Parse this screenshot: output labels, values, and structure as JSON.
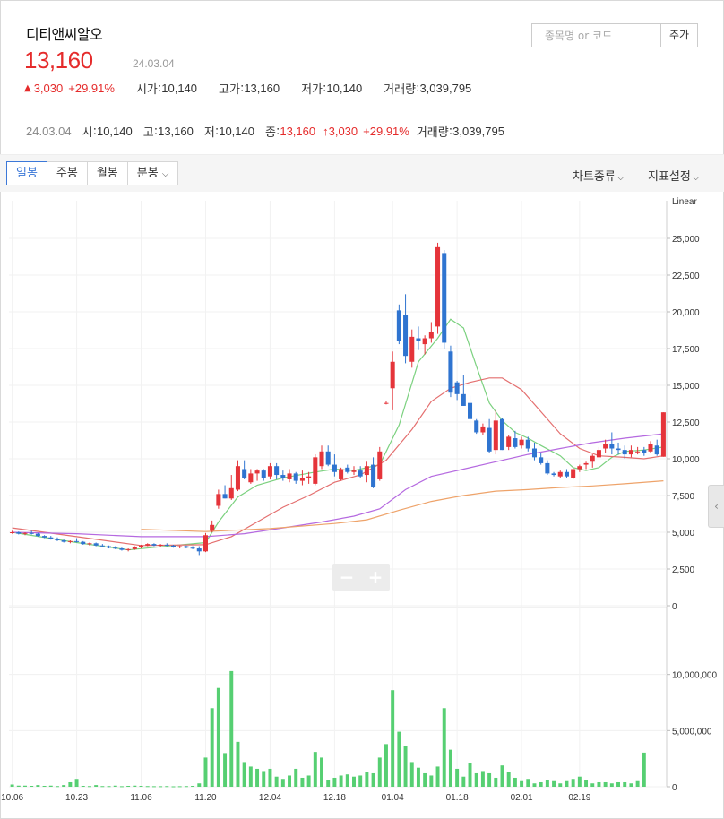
{
  "stock": {
    "name": "디티앤씨알오",
    "price": "13,160",
    "date": "24.03.04",
    "change_arrow": "▲",
    "change": "3,030",
    "change_pct": "+29.91%",
    "open_label": "시가",
    "open": "10,140",
    "high_label": "고가",
    "high": "13,160",
    "low_label": "저가",
    "low": "10,140",
    "volume_label": "거래량",
    "volume": "3,039,795"
  },
  "search": {
    "placeholder": "종목명 or 코드",
    "add_label": "추가"
  },
  "ohlc_row": {
    "date": "24.03.04",
    "open_label": "시",
    "open": "10,140",
    "high_label": "고",
    "high": "13,160",
    "low_label": "저",
    "low": "10,140",
    "close_label": "종",
    "close": "13,160",
    "change": "↑3,030",
    "change_pct": "+29.91%",
    "volume_label": "거래량",
    "volume": "3,039,795"
  },
  "toolbar": {
    "tabs": [
      "일봉",
      "주봉",
      "월봉",
      "분봉"
    ],
    "active_tab": 0,
    "chart_type": "차트종류",
    "indicator": "지표설정"
  },
  "colors": {
    "up": "#e5343a",
    "down": "#2f74d0",
    "ma5": "#7bd17f",
    "ma20": "#e46f6f",
    "ma60": "#b569e0",
    "ma120": "#eea36a",
    "volume": "#56cf72"
  },
  "chart_data": {
    "type": "candlestick",
    "scale_label": "Linear",
    "price_ticks": [
      0,
      2500,
      5000,
      7500,
      10000,
      12500,
      15000,
      17500,
      20000,
      22500,
      25000
    ],
    "volume_ticks": [
      0,
      5000000,
      10000000
    ],
    "ylim": [
      0,
      26000
    ],
    "volume_ylim": [
      0,
      13500000
    ],
    "x_ticks": [
      {
        "i": 0,
        "label": "10.06"
      },
      {
        "i": 10,
        "label": "10.23"
      },
      {
        "i": 20,
        "label": "11.06"
      },
      {
        "i": 30,
        "label": "11.20"
      },
      {
        "i": 40,
        "label": "12.04"
      },
      {
        "i": 50,
        "label": "12.18"
      },
      {
        "i": 59,
        "label": "01.04"
      },
      {
        "i": 69,
        "label": "01.18"
      },
      {
        "i": 79,
        "label": "02.01"
      },
      {
        "i": 88,
        "label": "02.19"
      }
    ],
    "candles": [
      [
        5000,
        5100,
        4900,
        5000
      ],
      [
        5000,
        5050,
        4850,
        4900
      ],
      [
        4900,
        5000,
        4800,
        4950
      ],
      [
        4950,
        5100,
        4850,
        4900
      ],
      [
        4900,
        4950,
        4700,
        4750
      ],
      [
        4750,
        4800,
        4600,
        4650
      ],
      [
        4650,
        4750,
        4500,
        4550
      ],
      [
        4550,
        4650,
        4400,
        4450
      ],
      [
        4450,
        4500,
        4300,
        4350
      ],
      [
        4350,
        4450,
        4250,
        4400
      ],
      [
        4400,
        4600,
        4300,
        4350
      ],
      [
        4350,
        4400,
        4150,
        4200
      ],
      [
        4200,
        4300,
        4100,
        4250
      ],
      [
        4250,
        4300,
        4050,
        4100
      ],
      [
        4100,
        4200,
        4000,
        4050
      ],
      [
        4050,
        4100,
        3900,
        3950
      ],
      [
        3950,
        4050,
        3850,
        3900
      ],
      [
        3900,
        3950,
        3750,
        3800
      ],
      [
        3800,
        3900,
        3700,
        3850
      ],
      [
        3850,
        4050,
        3800,
        4000
      ],
      [
        4000,
        4150,
        3900,
        4100
      ],
      [
        4100,
        4250,
        4050,
        4200
      ],
      [
        4200,
        4250,
        4050,
        4100
      ],
      [
        4100,
        4200,
        4000,
        4150
      ],
      [
        4150,
        4250,
        4050,
        4100
      ],
      [
        4100,
        4150,
        3950,
        4000
      ],
      [
        4000,
        4100,
        3900,
        4050
      ],
      [
        4050,
        4100,
        3900,
        3950
      ],
      [
        3950,
        4050,
        3850,
        3900
      ],
      [
        3900,
        4050,
        3450,
        3700
      ],
      [
        3700,
        4950,
        3650,
        4800
      ],
      [
        5100,
        5800,
        5000,
        5500
      ],
      [
        6800,
        7900,
        6600,
        7600
      ],
      [
        7600,
        8200,
        7300,
        7300
      ],
      [
        7300,
        8900,
        7200,
        8000
      ],
      [
        7900,
        9900,
        7800,
        9500
      ],
      [
        9300,
        9900,
        8600,
        8700
      ],
      [
        8400,
        9300,
        8300,
        9000
      ],
      [
        9000,
        9300,
        8500,
        9200
      ],
      [
        9200,
        9300,
        8500,
        8700
      ],
      [
        8800,
        9700,
        8600,
        9500
      ],
      [
        9500,
        9700,
        8600,
        8900
      ],
      [
        8900,
        9200,
        8500,
        8700
      ],
      [
        8600,
        9300,
        8400,
        9000
      ],
      [
        9000,
        9100,
        8300,
        8500
      ],
      [
        8500,
        9200,
        8200,
        8700
      ],
      [
        8700,
        9100,
        8300,
        8800
      ],
      [
        8300,
        10300,
        8200,
        10100
      ],
      [
        9500,
        10900,
        9300,
        10500
      ],
      [
        10500,
        10900,
        9500,
        9600
      ],
      [
        9600,
        10300,
        8800,
        9100
      ],
      [
        8600,
        9400,
        8500,
        9300
      ],
      [
        9400,
        9600,
        9000,
        9100
      ],
      [
        9100,
        9500,
        8900,
        9200
      ],
      [
        9200,
        9500,
        8700,
        8800
      ],
      [
        8900,
        9800,
        8400,
        9500
      ],
      [
        9600,
        10100,
        8000,
        8100
      ],
      [
        8600,
        10800,
        8500,
        10500
      ],
      [
        13800,
        13900,
        13700,
        13800
      ],
      [
        14800,
        17300,
        13300,
        16600
      ],
      [
        20100,
        20500,
        17800,
        18000
      ],
      [
        19800,
        21200,
        16500,
        17000
      ],
      [
        16600,
        18800,
        16200,
        18300
      ],
      [
        18200,
        19000,
        17400,
        18000
      ],
      [
        17800,
        18400,
        17100,
        18200
      ],
      [
        18200,
        19300,
        17900,
        18600
      ],
      [
        19000,
        24700,
        18500,
        24400
      ],
      [
        24000,
        24200,
        17500,
        17900
      ],
      [
        17300,
        17700,
        14200,
        14500
      ],
      [
        15200,
        15300,
        14000,
        14400
      ],
      [
        14400,
        15700,
        13600,
        13600
      ],
      [
        13800,
        14300,
        12000,
        12700
      ],
      [
        12600,
        12700,
        11700,
        11800
      ],
      [
        11800,
        12400,
        11600,
        12200
      ],
      [
        12100,
        12700,
        10400,
        10500
      ],
      [
        10600,
        13300,
        10300,
        12600
      ],
      [
        12700,
        12800,
        10600,
        10600
      ],
      [
        10800,
        11600,
        10600,
        11500
      ],
      [
        11400,
        11900,
        10700,
        10800
      ],
      [
        10900,
        11500,
        10700,
        11300
      ],
      [
        11300,
        11500,
        10500,
        10700
      ],
      [
        10700,
        11100,
        9900,
        10100
      ],
      [
        10100,
        10400,
        9600,
        9700
      ],
      [
        9700,
        9900,
        8900,
        9000
      ],
      [
        9000,
        9100,
        8800,
        8900
      ],
      [
        8800,
        9200,
        8700,
        9100
      ],
      [
        9100,
        9300,
        8700,
        8800
      ],
      [
        8700,
        9400,
        8600,
        9300
      ],
      [
        9300,
        9600,
        9100,
        9500
      ],
      [
        9600,
        9800,
        9300,
        9700
      ],
      [
        9800,
        10300,
        9400,
        10200
      ],
      [
        10100,
        10800,
        10100,
        10600
      ],
      [
        10700,
        11300,
        10400,
        11000
      ],
      [
        11000,
        11800,
        10300,
        10700
      ],
      [
        10700,
        11100,
        10300,
        10600
      ],
      [
        10600,
        10900,
        10000,
        10300
      ],
      [
        10300,
        10900,
        10100,
        10600
      ],
      [
        10500,
        10800,
        10300,
        10500
      ],
      [
        10600,
        10800,
        10200,
        10400
      ],
      [
        10500,
        11200,
        10400,
        11000
      ],
      [
        10900,
        11300,
        10200,
        10300
      ],
      [
        10140,
        13160,
        10140,
        13160
      ]
    ],
    "volumes": [
      200000,
      100000,
      100000,
      80000,
      150000,
      80000,
      100000,
      60000,
      150000,
      400000,
      700000,
      80000,
      60000,
      150000,
      60000,
      60000,
      100000,
      50000,
      80000,
      100000,
      80000,
      60000,
      50000,
      50000,
      60000,
      40000,
      50000,
      60000,
      80000,
      300000,
      2600000,
      7000000,
      8800000,
      3000000,
      10300000,
      4000000,
      2200000,
      1800000,
      1600000,
      1400000,
      1600000,
      900000,
      700000,
      1000000,
      1600000,
      800000,
      1000000,
      3100000,
      2600000,
      600000,
      800000,
      1000000,
      1100000,
      900000,
      1000000,
      1300000,
      1200000,
      2600000,
      3800000,
      8600000,
      4900000,
      3600000,
      2200000,
      1700000,
      1200000,
      1000000,
      1800000,
      7000000,
      3300000,
      1600000,
      900000,
      2100000,
      1200000,
      1400000,
      1200000,
      800000,
      1900000,
      1300000,
      800000,
      500000,
      700000,
      300000,
      400000,
      600000,
      500000,
      300000,
      500000,
      700000,
      900000,
      600000,
      300000,
      400000,
      400000,
      300000,
      400000,
      400000,
      300000,
      500000,
      3040000
    ],
    "moving_averages": [
      {
        "name": "MA5",
        "color": "#7bd17f",
        "points": [
          [
            0,
            5000
          ],
          [
            10,
            4300
          ],
          [
            18,
            3800
          ],
          [
            25,
            4100
          ],
          [
            30,
            4300
          ],
          [
            32,
            5700
          ],
          [
            35,
            7400
          ],
          [
            38,
            8200
          ],
          [
            42,
            8700
          ],
          [
            47,
            9100
          ],
          [
            50,
            9300
          ],
          [
            53,
            9200
          ],
          [
            57,
            9600
          ],
          [
            60,
            12300
          ],
          [
            63,
            16600
          ],
          [
            66,
            18200
          ],
          [
            68,
            19500
          ],
          [
            70,
            18900
          ],
          [
            72,
            16300
          ],
          [
            74,
            13800
          ],
          [
            76,
            12600
          ],
          [
            78,
            11800
          ],
          [
            80,
            11400
          ],
          [
            82,
            10900
          ],
          [
            85,
            10200
          ],
          [
            87,
            9400
          ],
          [
            89,
            9200
          ],
          [
            91,
            9400
          ],
          [
            93,
            10100
          ],
          [
            95,
            10500
          ],
          [
            98,
            10600
          ],
          [
            101,
            10800
          ]
        ]
      },
      {
        "name": "MA20",
        "color": "#e46f6f",
        "points": [
          [
            0,
            5300
          ],
          [
            10,
            4700
          ],
          [
            20,
            4100
          ],
          [
            30,
            4150
          ],
          [
            34,
            4700
          ],
          [
            38,
            5700
          ],
          [
            42,
            6700
          ],
          [
            46,
            7500
          ],
          [
            50,
            8400
          ],
          [
            54,
            8900
          ],
          [
            58,
            9900
          ],
          [
            62,
            12000
          ],
          [
            65,
            13900
          ],
          [
            68,
            14800
          ],
          [
            71,
            15200
          ],
          [
            74,
            15500
          ],
          [
            76,
            15500
          ],
          [
            79,
            14700
          ],
          [
            82,
            13200
          ],
          [
            85,
            11700
          ],
          [
            88,
            10700
          ],
          [
            91,
            10200
          ],
          [
            95,
            10100
          ],
          [
            98,
            10000
          ],
          [
            101,
            10200
          ]
        ]
      },
      {
        "name": "MA60",
        "color": "#b569e0",
        "points": [
          [
            0,
            5000
          ],
          [
            10,
            4900
          ],
          [
            20,
            4700
          ],
          [
            30,
            4700
          ],
          [
            36,
            4900
          ],
          [
            42,
            5300
          ],
          [
            48,
            5700
          ],
          [
            53,
            6100
          ],
          [
            57,
            6600
          ],
          [
            61,
            7900
          ],
          [
            65,
            8800
          ],
          [
            70,
            9300
          ],
          [
            75,
            9800
          ],
          [
            80,
            10300
          ],
          [
            85,
            10700
          ],
          [
            90,
            11100
          ],
          [
            95,
            11400
          ],
          [
            101,
            11700
          ]
        ]
      },
      {
        "name": "MA120",
        "color": "#eea36a",
        "points": [
          [
            20,
            5200
          ],
          [
            30,
            5050
          ],
          [
            40,
            5250
          ],
          [
            50,
            5600
          ],
          [
            55,
            5850
          ],
          [
            60,
            6500
          ],
          [
            65,
            7100
          ],
          [
            70,
            7500
          ],
          [
            75,
            7800
          ],
          [
            80,
            7900
          ],
          [
            85,
            8050
          ],
          [
            90,
            8150
          ],
          [
            95,
            8300
          ],
          [
            101,
            8500
          ]
        ]
      }
    ]
  }
}
